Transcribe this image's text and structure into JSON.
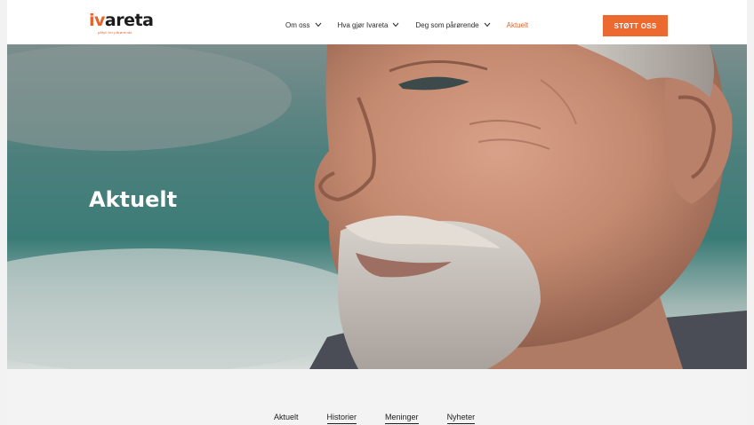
{
  "header": {
    "logo": {
      "prefix": "iv",
      "suffix": "areta",
      "tagline": "påfyll for pårørende"
    },
    "nav": [
      {
        "label": "Om oss",
        "has_dropdown": true
      },
      {
        "label": "Hva gjør Ivareta",
        "has_dropdown": true
      },
      {
        "label": "Deg som pårørende",
        "has_dropdown": true
      },
      {
        "label": "Aktuelt",
        "has_dropdown": false,
        "active": true
      }
    ],
    "cta_label": "STØTT OSS"
  },
  "hero": {
    "title": "Aktuelt"
  },
  "subnav": {
    "items": [
      {
        "label": "Aktuelt",
        "active": false
      },
      {
        "label": "Historier",
        "active": true
      },
      {
        "label": "Meninger",
        "active": true
      },
      {
        "label": "Nyheter",
        "active": true
      }
    ]
  },
  "colors": {
    "accent": "#e8622a",
    "header_bg": "#ffffff",
    "page_bg": "#f3f3f3",
    "text": "#1d1d1d"
  }
}
